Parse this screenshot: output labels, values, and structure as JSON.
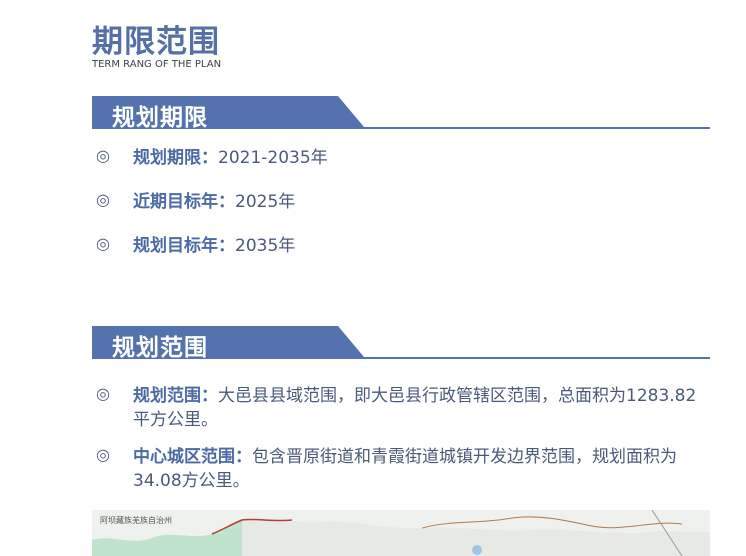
{
  "header": {
    "title": "期限范围",
    "subtitle": "TERM RANG OF THE PLAN"
  },
  "sections": [
    {
      "label": "规划期限",
      "items": [
        {
          "key": "规划期限：",
          "value": "2021-2035年"
        },
        {
          "key": "近期目标年：",
          "value": "2025年"
        },
        {
          "key": "规划目标年：",
          "value": "2035年"
        }
      ]
    },
    {
      "label": "规划范围",
      "items": [
        {
          "key": "规划范围：",
          "value": "大邑县县域范围，即大邑县行政管辖区范围，总面积为1283.82平方公里。"
        },
        {
          "key": "中心城区范围：",
          "value": "包含晋原街道和青霞街道城镇开发边界范围，规划面积为34.08方公里。"
        }
      ]
    }
  ],
  "map": {
    "region_label": "阿坝藏族羌族自治州"
  },
  "colors": {
    "accent": "#5470a5",
    "bar_fill": "#5472ad",
    "text": "#4a5a7a"
  },
  "icons": {
    "bullet": "double-circle-icon"
  }
}
